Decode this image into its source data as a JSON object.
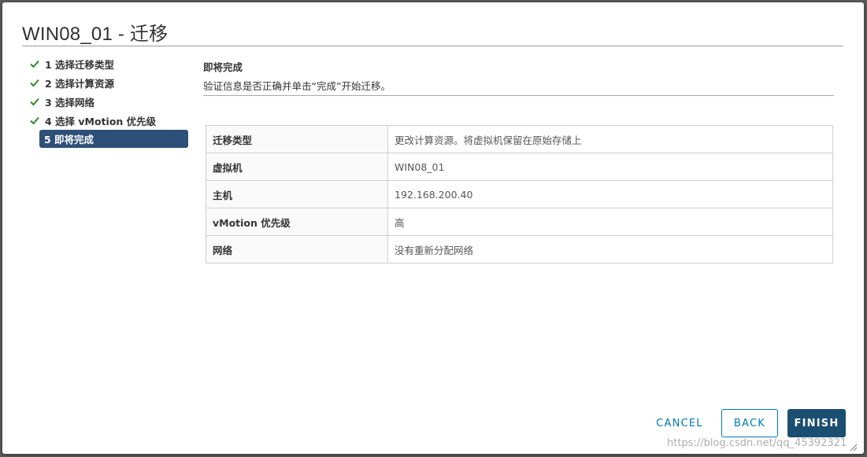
{
  "dialog": {
    "title": "WIN08_01 - 迁移"
  },
  "steps": [
    {
      "label": "1 选择迁移类型",
      "done": true
    },
    {
      "label": "2 选择计算资源",
      "done": true
    },
    {
      "label": "3 选择网络",
      "done": true
    },
    {
      "label": "4 选择 vMotion 优先级",
      "done": true
    },
    {
      "label": "5 即将完成",
      "done": false
    }
  ],
  "content": {
    "title": "即将完成",
    "description": "验证信息是否正确并单击“完成”开始迁移。"
  },
  "summary": [
    {
      "key": "迁移类型",
      "value": "更改计算资源。将虚拟机保留在原始存储上"
    },
    {
      "key": "虚拟机",
      "value": "WIN08_01"
    },
    {
      "key": "主机",
      "value": "192.168.200.40"
    },
    {
      "key": "vMotion 优先级",
      "value": "高"
    },
    {
      "key": "网络",
      "value": "没有重新分配网络"
    }
  ],
  "footer": {
    "cancel_label": "CANCEL",
    "back_label": "BACK",
    "finish_label": "FINISH"
  },
  "watermark": "https://blog.csdn.net/qq_45392321",
  "colors": {
    "accent": "#0079b8",
    "active_step": "#2d5078",
    "finish_button": "#1b4f72",
    "check": "#2e8b2e"
  },
  "icons": {
    "step_done": "check-icon",
    "resize": "resize-grip-icon"
  }
}
